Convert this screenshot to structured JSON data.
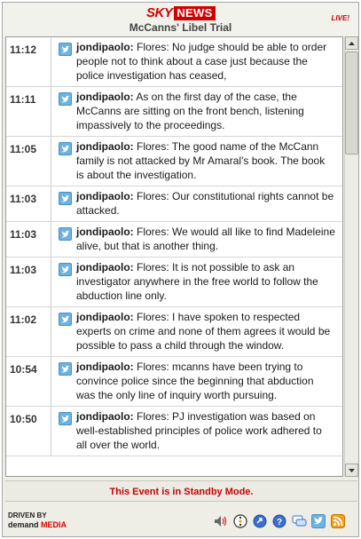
{
  "header": {
    "logo_sky": "SKY",
    "logo_news": "NEWS",
    "title": "McCanns' Libel Trial",
    "live": "LIVE!"
  },
  "feed": [
    {
      "time": "11:12",
      "user": "jondipaolo:",
      "text": "Flores: No judge should be able to order people not to think about a case just because the police investigation has ceased,"
    },
    {
      "time": "11:11",
      "user": "jondipaolo:",
      "text": "As on the first day of the case, the McCanns are sitting on the front bench, listening impassively to the proceedings."
    },
    {
      "time": "11:05",
      "user": "jondipaolo:",
      "text": "Flores: The good name of the McCann family is not attacked by Mr Amaral's book. The book is about the investigation."
    },
    {
      "time": "11:03",
      "user": "jondipaolo:",
      "text": "Flores: Our constitutional rights cannot be attacked."
    },
    {
      "time": "11:03",
      "user": "jondipaolo:",
      "text": "Flores: We would all like to find Madeleine alive, but that is another thing."
    },
    {
      "time": "11:03",
      "user": "jondipaolo:",
      "text": "Flores: It is not possible to ask an investigator anywhere in the free world to follow the abduction line only."
    },
    {
      "time": "11:02",
      "user": "jondipaolo:",
      "text": "Flores: I have spoken to respected experts on crime and none of them agrees it would be possible to pass a child through the window."
    },
    {
      "time": "10:54",
      "user": "jondipaolo:",
      "text": "Flores: mcanns have been trying to convince police since the beginning that abduction was the only line of inquiry worth pursuing."
    },
    {
      "time": "10:50",
      "user": "jondipaolo:",
      "text": "Flores: PJ investigation was based on well-established principles of police work adhered to all over the world."
    }
  ],
  "status": {
    "standby": "This Event is in Standby Mode."
  },
  "footer": {
    "driven_by": "DRIVEN BY",
    "brand_demand": "demand",
    "brand_media": "MEDIA"
  },
  "colors": {
    "brand_red": "#d40000",
    "twitter_blue": "#6cb3e2",
    "standby_red": "#cc0000"
  }
}
